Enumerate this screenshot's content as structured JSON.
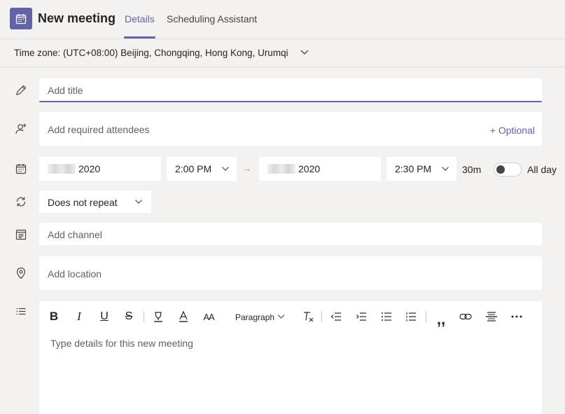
{
  "header": {
    "title": "New meeting",
    "tabs": [
      {
        "label": "Details",
        "active": true
      },
      {
        "label": "Scheduling Assistant",
        "active": false
      }
    ],
    "app_icon": "calendar-icon"
  },
  "timezone": {
    "label": "Time zone: (UTC+08:00) Beijing, Chongqing, Hong Kong, Urumqi"
  },
  "form": {
    "title_placeholder": "Add title",
    "attendees_placeholder": "Add required attendees",
    "optional_label": "+ Optional",
    "start_date_year": "2020",
    "start_time": "2:00 PM",
    "end_date_year": "2020",
    "end_time": "2:30 PM",
    "duration": "30m",
    "all_day_label": "All day",
    "all_day_on": false,
    "repeat": "Does not repeat",
    "channel_placeholder": "Add channel",
    "location_placeholder": "Add location"
  },
  "editor": {
    "paragraph_label": "Paragraph",
    "placeholder": "Type details for this new meeting"
  },
  "colors": {
    "accent": "#6264a7",
    "background": "#f3f2f1"
  }
}
